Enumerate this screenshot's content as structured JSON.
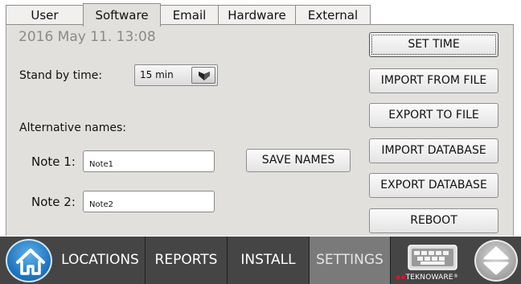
{
  "tabs": [
    {
      "label": "User",
      "active": false
    },
    {
      "label": "Software",
      "active": true
    },
    {
      "label": "Email",
      "active": false
    },
    {
      "label": "Hardware",
      "active": false
    },
    {
      "label": "External",
      "active": false
    }
  ],
  "datetime": "2016 May 11. 13:08",
  "standby": {
    "label": "Stand by time:",
    "value": "15 min"
  },
  "alt_names": {
    "heading": "Alternative names:",
    "note1": {
      "label": "Note 1:",
      "value": "Note1"
    },
    "note2": {
      "label": "Note 2:",
      "value": "Note2"
    },
    "save_label": "SAVE NAMES"
  },
  "actions": {
    "set_time": "SET TIME",
    "import_file": "IMPORT FROM FILE",
    "export_file": "EXPORT TO FILE",
    "import_db": "IMPORT DATABASE",
    "export_db": "EXPORT DATABASE",
    "reboot": "REBOOT"
  },
  "nav": {
    "locations": "LOCATIONS",
    "reports": "REPORTS",
    "install": "INSTALL",
    "settings": "SETTINGS",
    "brand": "TEKNOWARE",
    "brand_mark": "®"
  },
  "icons": [
    "home-icon",
    "keyboard-icon",
    "up-down-icon",
    "chevron-down-icon"
  ],
  "colors": {
    "panel": "#e2e0dc",
    "navbar": "#454545",
    "nav_active": "#7a7a7a",
    "home_blue": "#1f74c0",
    "brand_red": "#e0102d"
  }
}
